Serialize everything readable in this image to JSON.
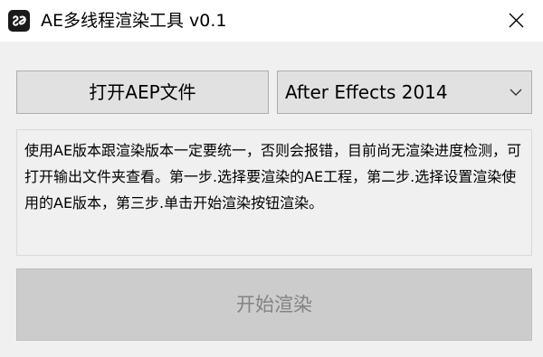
{
  "window": {
    "title": "AE多线程渲染工具 v0.1",
    "app_icon": "app-logo-icon",
    "close_icon": "close-icon"
  },
  "controls": {
    "open_button_label": "打开AEP文件",
    "version_select": {
      "selected": "After Effects 2014",
      "icon": "chevron-down-icon"
    },
    "info_text": "使用AE版本跟渲染版本一定要统一，否则会报错，目前尚无渲染进度检测，可打开输出文件夹查看。第一步.选择要渲染的AE工程，第二步.选择设置渲染使用的AE版本，第三步.单击开始渲染按钮渲染。",
    "start_button_label": "开始渲染",
    "start_button_enabled": false
  },
  "colors": {
    "window_bg": "#f0f0f0",
    "titlebar_bg": "#ffffff",
    "button_bg": "#e1e1e1",
    "disabled_button_bg": "#cccccc",
    "disabled_text": "#838383"
  }
}
